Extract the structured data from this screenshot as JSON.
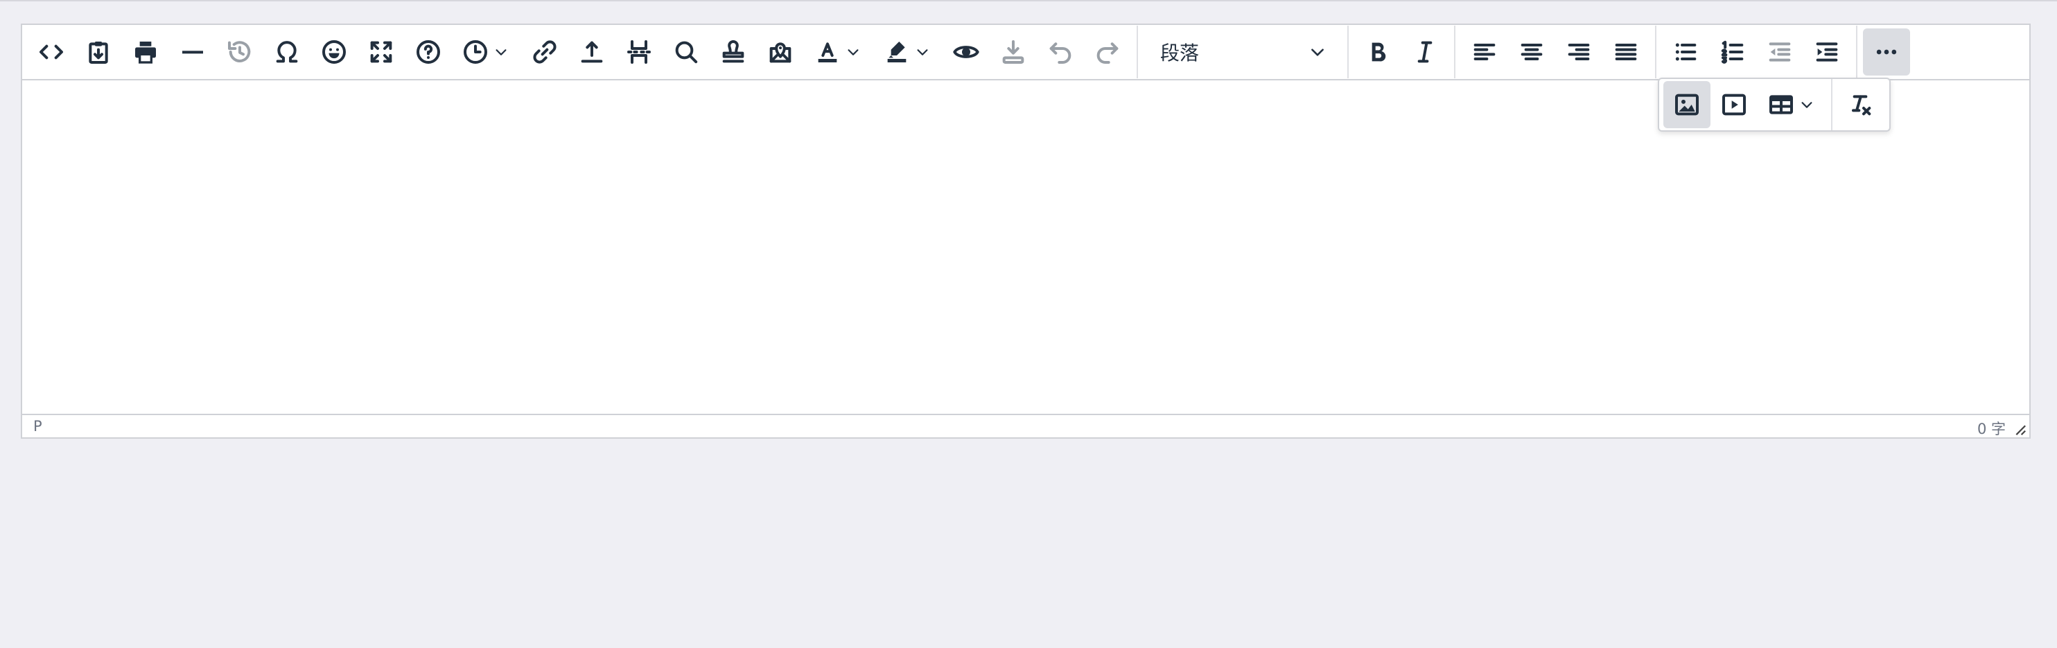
{
  "toolbar": {
    "block_format_select": {
      "value": "段落",
      "options_visible": [
        "段落"
      ]
    },
    "buttons": [
      {
        "name": "source-code",
        "icon": "code-icon"
      },
      {
        "name": "paste-text",
        "icon": "clipboard-icon"
      },
      {
        "name": "print",
        "icon": "printer-icon"
      },
      {
        "name": "horizontal-line",
        "icon": "horizontal-line-icon"
      },
      {
        "name": "restore-draft",
        "icon": "history-icon"
      },
      {
        "name": "special-character",
        "icon": "omega-icon"
      },
      {
        "name": "emoticons",
        "icon": "smiley-icon"
      },
      {
        "name": "fullscreen",
        "icon": "fullscreen-icon"
      },
      {
        "name": "help",
        "icon": "help-icon"
      },
      {
        "name": "insert-datetime",
        "icon": "clock-icon"
      },
      {
        "name": "link",
        "icon": "link-icon"
      },
      {
        "name": "upload",
        "icon": "upload-icon"
      },
      {
        "name": "page-break",
        "icon": "page-break-icon"
      },
      {
        "name": "search-replace",
        "icon": "search-icon"
      },
      {
        "name": "stamp",
        "icon": "stamp-icon"
      },
      {
        "name": "map",
        "icon": "map-pin-icon"
      },
      {
        "name": "text-color",
        "icon": "text-color-icon"
      },
      {
        "name": "highlight-color",
        "icon": "highlighter-icon"
      },
      {
        "name": "preview",
        "icon": "eye-icon"
      },
      {
        "name": "download",
        "icon": "download-icon"
      },
      {
        "name": "undo",
        "icon": "undo-icon"
      },
      {
        "name": "redo",
        "icon": "redo-icon"
      },
      {
        "name": "bold",
        "icon": "bold-icon"
      },
      {
        "name": "italic",
        "icon": "italic-icon"
      },
      {
        "name": "align-left",
        "icon": "align-left-icon"
      },
      {
        "name": "align-center",
        "icon": "align-center-icon"
      },
      {
        "name": "align-right",
        "icon": "align-right-icon"
      },
      {
        "name": "justify",
        "icon": "align-justify-icon"
      },
      {
        "name": "bullet-list",
        "icon": "bullet-list-icon"
      },
      {
        "name": "numbered-list",
        "icon": "numbered-list-icon"
      },
      {
        "name": "outdent",
        "icon": "outdent-icon"
      },
      {
        "name": "indent",
        "icon": "indent-icon"
      },
      {
        "name": "more",
        "icon": "more-icon"
      }
    ]
  },
  "overflow_menu": {
    "buttons": [
      {
        "name": "insert-image",
        "icon": "image-icon"
      },
      {
        "name": "insert-media",
        "icon": "video-icon"
      },
      {
        "name": "table",
        "icon": "table-icon"
      },
      {
        "name": "clear-formatting",
        "icon": "clear-format-icon"
      }
    ]
  },
  "statusbar": {
    "element_path": "P",
    "word_count": "0 字"
  },
  "colors": {
    "page_bg": "#efeff4",
    "editor_bg": "#ffffff",
    "border": "#cfd1d6",
    "icon": "#222f3e",
    "active_bg": "#dbdde2"
  }
}
